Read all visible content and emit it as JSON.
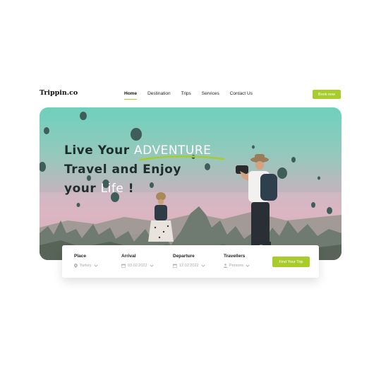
{
  "brand": {
    "logo_text": "Trippin.co"
  },
  "nav": {
    "items": [
      {
        "label": "Home",
        "active": true
      },
      {
        "label": "Destination",
        "active": false
      },
      {
        "label": "Trips",
        "active": false
      },
      {
        "label": "Services",
        "active": false
      },
      {
        "label": "Contact Us",
        "active": false
      }
    ],
    "book_label": "Book now"
  },
  "hero": {
    "line1_a": "Live Your ",
    "line1_b": "ADVENTURE",
    "line2": "Travel and Enjoy",
    "line3_a": "your ",
    "line3_b": "Life",
    "line3_c": " !"
  },
  "search": {
    "place": {
      "label": "Place",
      "value": "Turkey",
      "icon": "location-pin-icon"
    },
    "arrival": {
      "label": "Arrival",
      "value": "03.02.2022",
      "icon": "calendar-icon"
    },
    "departure": {
      "label": "Departure",
      "value": "12.02.2022",
      "icon": "calendar-icon"
    },
    "travellers": {
      "label": "Travellers",
      "value": "Persons",
      "icon": "person-icon"
    },
    "button_label": "Find Your Trip"
  },
  "colors": {
    "accent": "#a8cc2c",
    "headline_dark": "#1f2d2a",
    "sky_top": "#6fd0bd",
    "sky_bottom": "#d8aebd"
  }
}
